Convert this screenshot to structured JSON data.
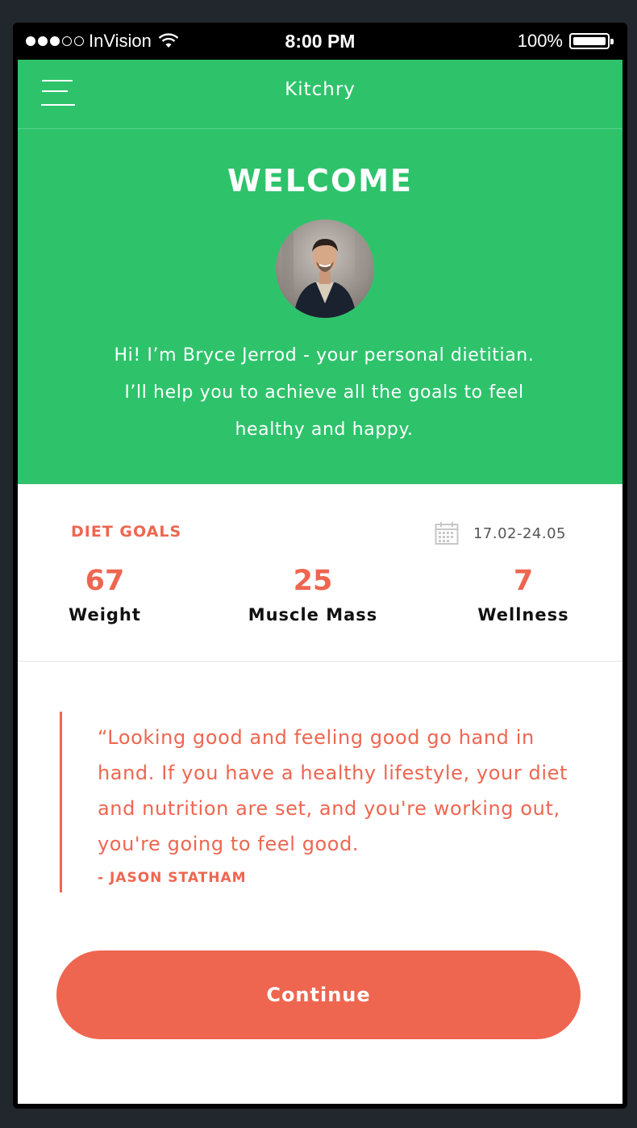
{
  "status_bar": {
    "carrier": "InVision",
    "time": "8:00 PM",
    "battery": "100%",
    "signal_icon": "signal-dots-icon",
    "wifi_icon": "wifi-icon",
    "battery_icon": "battery-icon"
  },
  "header": {
    "app_title": "Kitchry",
    "menu_icon": "hamburger-menu-icon",
    "background_color": "#2ec36b"
  },
  "welcome": {
    "title": "WELCOME",
    "intro": "Hi! I’m Bryce Jerrod - your personal dietitian. I’ll help you to achieve all the goals to feel healthy and happy."
  },
  "diet_goals": {
    "heading": "DIET GOALS",
    "date_range": "17.02-24.05",
    "calendar_icon": "calendar-icon",
    "stats": [
      {
        "value": "67",
        "label": "Weight"
      },
      {
        "value": "25",
        "label": "Muscle Mass"
      },
      {
        "value": "7",
        "label": "Wellness"
      }
    ]
  },
  "quote": {
    "text": "“Looking good and feeling good go hand in hand. If you have a healthy lifestyle, your diet and nutrition are set, and you're working out, you're going to feel good.",
    "author": "- JASON STATHAM"
  },
  "actions": {
    "continue_label": "Continue",
    "accent_color": "#ee6650"
  }
}
